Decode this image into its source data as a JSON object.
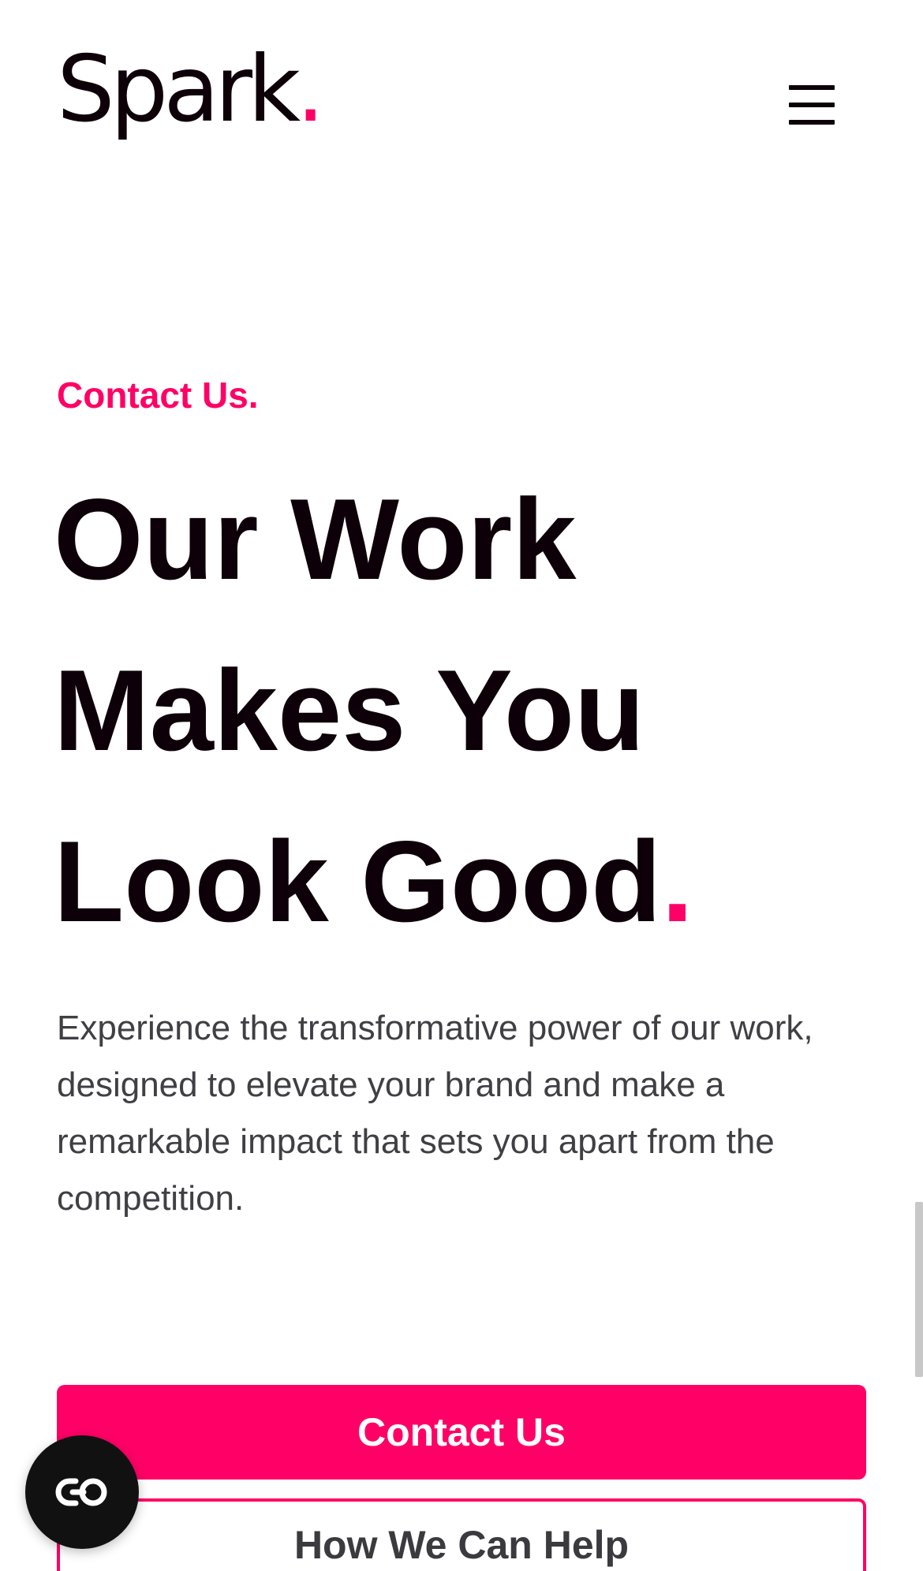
{
  "header": {
    "logo_text": "Spark",
    "logo_dot": ".",
    "menu_icon": "hamburger-menu-icon"
  },
  "hero": {
    "eyebrow": "Contact Us.",
    "headline_lines": [
      "Our Work",
      "Makes You",
      "Look Good"
    ],
    "headline_dot": ".",
    "description": "Experience the transformative power of our work, designed to elevate your brand and make a remarkable impact that sets you apart from the competition."
  },
  "actions": {
    "primary_label": "Contact Us",
    "secondary_label": "How We Can Help"
  },
  "widget": {
    "icon": "accessibility-toggle-icon"
  },
  "colors": {
    "accent": "#ff0066",
    "heading": "#0d0008",
    "body_text": "#3f3f44",
    "widget_bg": "#111111",
    "background": "#ffffff"
  }
}
